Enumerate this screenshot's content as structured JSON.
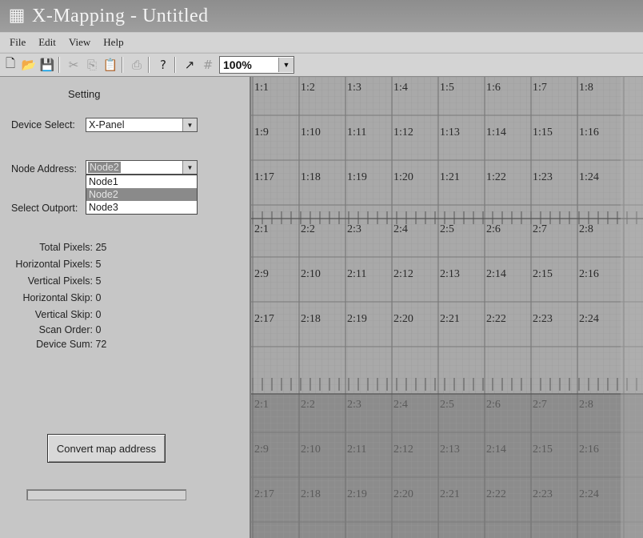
{
  "window": {
    "title": "X-Mapping - Untitled"
  },
  "menu": [
    "File",
    "Edit",
    "View",
    "Help"
  ],
  "toolbar": {
    "icons": [
      "new-icon",
      "open-icon",
      "save-icon",
      "cut-icon",
      "copy-icon",
      "paste-icon",
      "print-icon",
      "help-icon",
      "pointer-icon",
      "grid-icon"
    ],
    "zoom": "100%"
  },
  "panel": {
    "title": "Setting",
    "device_label": "Device Select:",
    "device_value": "X-Panel",
    "node_label": "Node Address:",
    "node_value": "Node2",
    "node_options": [
      "Node1",
      "Node2",
      "Node3"
    ],
    "outport_label": "Select Outport:",
    "stats": [
      {
        "label": "Total Pixels:",
        "value": "25"
      },
      {
        "label": "Horizontal Pixels:",
        "value": "5"
      },
      {
        "label": "Vertical Pixels:",
        "value": "5"
      },
      {
        "label": "Horizontal Skip:",
        "value": "0"
      },
      {
        "label": "Vertical Skip:",
        "value": "0"
      },
      {
        "label": "Scan Order:",
        "value": "0"
      },
      {
        "label": "Device Sum:",
        "value": "72"
      }
    ],
    "convert_button": "Convert map address",
    "progress": 0
  },
  "map": {
    "blocks": [
      {
        "prefix": "1",
        "rows": [
          [
            "1:1",
            "1:2",
            "1:3",
            "1:4",
            "1:5",
            "1:6",
            "1:7",
            "1:8"
          ],
          [
            "1:9",
            "1:10",
            "1:11",
            "1:12",
            "1:13",
            "1:14",
            "1:15",
            "1:16"
          ],
          [
            "1:17",
            "1:18",
            "1:19",
            "1:20",
            "1:21",
            "1:22",
            "1:23",
            "1:24"
          ]
        ]
      },
      {
        "prefix": "2",
        "rows": [
          [
            "2:1",
            "2:2",
            "2:3",
            "2:4",
            "2:5",
            "2:6",
            "2:7",
            "2:8"
          ],
          [
            "2:9",
            "2:10",
            "2:11",
            "2:12",
            "2:13",
            "2:14",
            "2:15",
            "2:16"
          ],
          [
            "2:17",
            "2:18",
            "2:19",
            "2:20",
            "2:21",
            "2:22",
            "2:23",
            "2:24"
          ]
        ]
      },
      {
        "prefix": "2",
        "rows": [
          [
            "2:1",
            "2:2",
            "2:3",
            "2:4",
            "2:5",
            "2:6",
            "2:7",
            "2:8"
          ],
          [
            "2:9",
            "2:10",
            "2:11",
            "2:12",
            "2:13",
            "2:14",
            "2:15",
            "2:16"
          ],
          [
            "2:17",
            "2:18",
            "2:19",
            "2:20",
            "2:21",
            "2:22",
            "2:23",
            "2:24"
          ]
        ]
      }
    ]
  }
}
